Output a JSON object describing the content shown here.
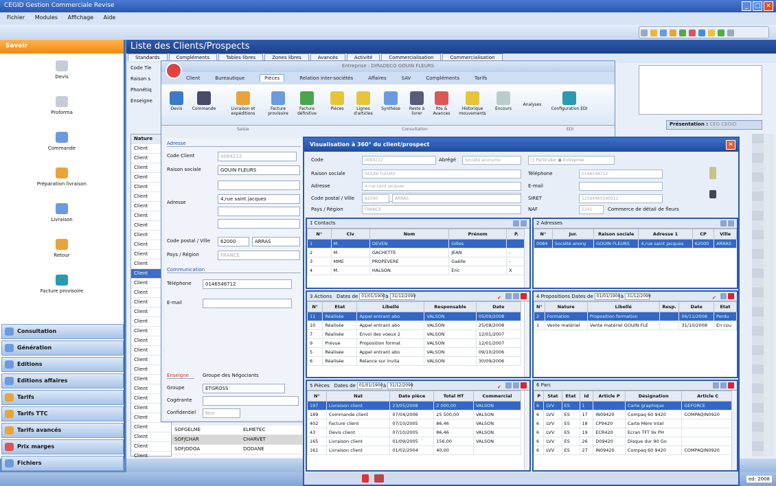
{
  "app": {
    "title": "CEGID  Gestion Commerciale  Revise",
    "menu": [
      "Fichier",
      "Modules",
      "Affichage",
      "Aide"
    ]
  },
  "sidebar": {
    "header": "Savoir",
    "items": [
      {
        "label": "Devis",
        "color": "#c8ccd8"
      },
      {
        "label": "Proforma",
        "color": "#c8ccd8"
      },
      {
        "label": "Commande",
        "color": "#6a9ae0"
      },
      {
        "label": "Préparation livraison",
        "color": "#e8a43a"
      },
      {
        "label": "Livraison",
        "color": "#6a9ae0"
      },
      {
        "label": "Retour",
        "color": "#e8a43a"
      },
      {
        "label": "Facture provisoire",
        "color": "#2a9ab0"
      }
    ],
    "groups": [
      "Consultation",
      "Génération",
      "Editions",
      "Editions affaires",
      "Tarifs",
      "Tarifs TTC",
      "Tarifs avancés",
      "Prix marges",
      "Fichiers"
    ]
  },
  "main": {
    "title": "Liste des Clients/Prospects",
    "tabs": [
      "Standards",
      "Compléments",
      "Tables libres",
      "Zones libres",
      "Avancés",
      "Activité",
      "Commercialisation",
      "Commercialisation"
    ],
    "form_labels": [
      "Code Tie",
      "Raison s",
      "Phonétiq",
      "Enseigne"
    ],
    "presentation_label": "Présentation :",
    "presentation_value": "CEG  CEGID",
    "list_header": "Nature",
    "list": [
      "Client",
      "Client",
      "Client",
      "Client",
      "Client",
      "Client",
      "Client",
      "Client",
      "Client",
      "Client",
      "Client",
      "Client",
      "Client",
      "Client",
      "Client",
      "Client",
      "Client",
      "Client",
      "Client",
      "Client",
      "Client",
      "Client",
      "Client",
      "Client",
      "Client",
      "Client",
      "Client",
      "Client",
      "Client",
      "Client",
      "Client",
      "Client",
      "Client"
    ],
    "bottom_rows": [
      [
        "Client",
        "SOFGELME",
        "ELMETEC"
      ],
      [
        "Client",
        "SOFJCHAR",
        "CHARVET"
      ],
      [
        "Client",
        "SOFJODOA",
        "DODANE"
      ]
    ],
    "status": "ed: 2008"
  },
  "entreprise": {
    "title": "Entreprise : DIRADECO GOUIN FLEURS",
    "tabs": [
      "Client",
      "Bureautique",
      "Pièces",
      "Relation inter-sociétés",
      "Affaires",
      "SAV",
      "Compléments",
      "Tarifs"
    ],
    "ribbon": [
      "Devis",
      "Commande",
      "Livraison et expéditions",
      "Facture provisoire",
      "Facture définitive",
      "Pièces",
      "Lignes d'articles",
      "Synthèse",
      "Reste à livrer",
      "Rte & Avances",
      "Historique mouvements",
      "Encours",
      "Analyses",
      "Configuration EDI"
    ],
    "groups": [
      "Saisie",
      "Consultation",
      "EDI"
    ],
    "adresse": {
      "section": "Adresse",
      "code_label": "Code Client",
      "code": "0084212",
      "raison_label": "Raison sociale",
      "raison": "GOUIN FLEURS",
      "adresse_label": "Adresse",
      "adresse": "4,rue saint jacques",
      "cp_label": "Code postal / Ville",
      "cp": "62000",
      "ville": "ARRAS",
      "pays_label": "Pays / Région",
      "pays": "FRANCE"
    },
    "comm": {
      "section": "Communication",
      "tel_label": "Téléphone",
      "tel": "0146548712",
      "email_label": "E-mail"
    },
    "enseigne": {
      "section": "Enseigne",
      "groupe_label": "Groupe",
      "groupe": "ETGROSS",
      "groupe_desc": "Groupe des Négociants",
      "cogerant_label": "Cogérante",
      "conf_label": "Confidentiel",
      "conf": "Non"
    }
  },
  "viz": {
    "title": "Visualisation à 360° du client/prospect",
    "fields": {
      "code_label": "Code",
      "code": "0084212",
      "abrege_label": "Abrégé",
      "abrege": "Société anonyme",
      "particulier": "Particulier",
      "entreprise": "Entreprise",
      "raison_label": "Raison sociale",
      "raison": "GOUIN FLEURS",
      "adresse_label": "Adresse",
      "adresse": "4,rue saint jacques",
      "cp_label": "Code postal / Ville",
      "cp": "62000",
      "ville": "ARRAS",
      "pays_label": "Pays / Région",
      "pays": "FRANCE",
      "tel_label": "Téléphone",
      "tel": "0146548712",
      "email_label": "E-mail",
      "siret_label": "SIRET",
      "siret": "12564465500012",
      "naf_label": "NAF",
      "naf": "5241",
      "naf_desc": "Commerce de détail de fleurs"
    },
    "contacts": {
      "title": "1 Contacts",
      "cols": [
        "N°",
        "Civ",
        "Nom",
        "Prénom",
        "P."
      ],
      "rows": [
        [
          "1",
          "M.",
          "DEVEN",
          "Gilles",
          ""
        ],
        [
          "2",
          "M.",
          "GACHETTE",
          "JEAN",
          "-"
        ],
        [
          "3",
          "MME",
          "PROPEVERE",
          "Gaëlle",
          "-"
        ],
        [
          "4",
          "M.",
          "HALSON",
          "Eric",
          "X"
        ]
      ]
    },
    "adresses": {
      "title": "2 Adresses",
      "cols": [
        "N°",
        "Jur.",
        "Raison sociale",
        "Adresse 1",
        "CP",
        "Ville"
      ],
      "rows": [
        [
          "0084",
          "Société anony",
          "GOUIN FLEURS",
          "4,rue saint jacques",
          "62000",
          "ARRAS"
        ]
      ]
    },
    "actions": {
      "title": "3 Actions",
      "dates": "Dates de",
      "from": "01/01/1900",
      "to": "31/12/2099",
      "cols": [
        "N°",
        "Etat",
        "Libellé",
        "Responsable",
        "Date"
      ],
      "rows": [
        [
          "11",
          "Réalisée",
          "Appel entrant abo",
          "VALSON",
          "05/09/2008"
        ],
        [
          "10",
          "Réalisée",
          "Appel entrant abo",
          "VALSON",
          "25/08/2008"
        ],
        [
          "7",
          "Réalisée",
          "Envoi des voeux 2",
          "VALSON",
          "12/01/2007"
        ],
        [
          "9",
          "Prévue",
          "Proposition format",
          "VALSON",
          "12/01/2007"
        ],
        [
          "5",
          "Réalisée",
          "Appel entrant abo",
          "VALSON",
          "09/10/2006"
        ],
        [
          "6",
          "Réalisée",
          "Relance sur invita",
          "VALSON",
          "30/09/2006"
        ]
      ]
    },
    "propositions": {
      "title": "4 Propositions",
      "dates": "Dates de",
      "from": "01/01/1900",
      "to": "31/12/2099",
      "cols": [
        "N°",
        "Nature",
        "Libellé",
        "Resp.",
        "Date",
        "Etat"
      ],
      "rows": [
        [
          "2",
          "Formation",
          "Proposition formation",
          "",
          "06/11/2008",
          "Perdu"
        ],
        [
          "1",
          "Vente matériel",
          "Vente matériel GOUIN FLE",
          "",
          "31/10/2008",
          "En cou"
        ]
      ]
    },
    "pieces": {
      "title": "5 Pièces",
      "dates": "Dates de",
      "from": "01/01/1900",
      "to": "31/12/2099",
      "cols": [
        "N°",
        "Nat",
        "Date pièce",
        "Total HT",
        "Commercial"
      ],
      "rows": [
        [
          "197",
          "Livraison client",
          "23/05/2008",
          "2 000,00",
          "VALSON"
        ],
        [
          "189",
          "Commande client",
          "07/04/2006",
          "25 500,00",
          "VALSON"
        ],
        [
          "402",
          "Facture client",
          "07/10/2005",
          "86,46",
          "VALSON"
        ],
        [
          "43",
          "Devis client",
          "07/10/2005",
          "86,46",
          "VALSON"
        ],
        [
          "165",
          "Livraison client",
          "01/09/2005",
          "156,00",
          "VALSON"
        ],
        [
          "161",
          "Livraison client",
          "01/02/2004",
          "40,00",
          ""
        ]
      ]
    },
    "parc": {
      "title": "6 Parc",
      "cols": [
        "P",
        "Stat",
        "Etat",
        "Id",
        "Article P",
        "Désignation",
        "Article C"
      ],
      "rows": [
        [
          "6",
          "LVV",
          "ES",
          "1",
          "",
          "Carte graphique",
          "GEFORCE"
        ],
        [
          "6",
          "LVV",
          "ES",
          "17",
          "IN09420",
          "Compaq 60 9420",
          "COMPAQIN0920"
        ],
        [
          "6",
          "LVV",
          "ES",
          "18",
          "CP9420",
          "Carte Mère Intel",
          ""
        ],
        [
          "6",
          "LVV",
          "ES",
          "19",
          "ECR420",
          "Ecran TFT 9x PH",
          ""
        ],
        [
          "6",
          "LVV",
          "ES",
          "26",
          "D09420",
          "Disque dur 90 Go",
          ""
        ],
        [
          "6",
          "LVV",
          "ES",
          "27",
          "IN09420",
          "Compaq 60 9420",
          "COMPAQIN0920"
        ]
      ]
    }
  }
}
